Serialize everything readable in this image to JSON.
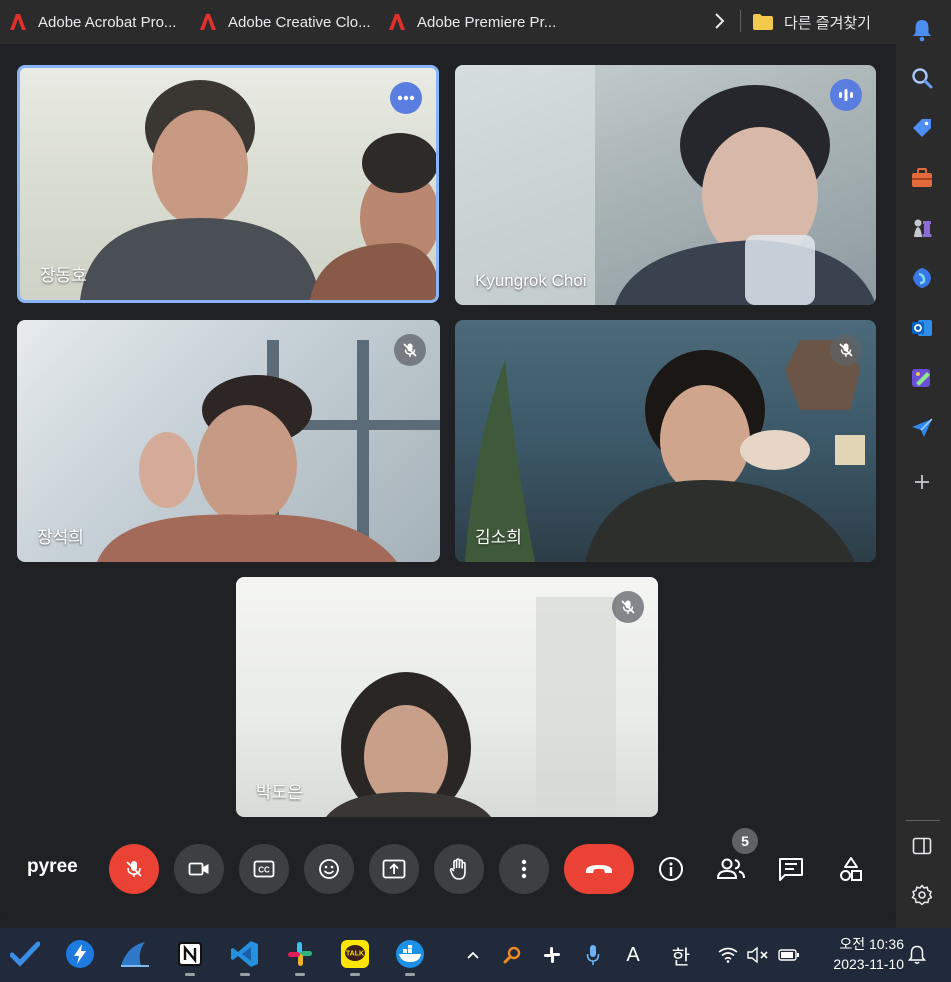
{
  "bookmarks": {
    "items": [
      {
        "label": "Adobe Acrobat Pro..."
      },
      {
        "label": "Adobe Creative Clo..."
      },
      {
        "label": "Adobe Premiere Pr..."
      }
    ],
    "other_label": "다른 즐겨찾기"
  },
  "tiles": [
    {
      "name": "장동호",
      "badge": "more-options-icon"
    },
    {
      "name": "Kyungrok Choi",
      "badge": "speaking-icon"
    },
    {
      "name": "장석희",
      "badge": "mic-off-icon"
    },
    {
      "name": "김소희",
      "badge": "mic-off-icon"
    },
    {
      "name": "박도은",
      "badge": "mic-off-icon"
    }
  ],
  "controls": {
    "meeting_name": "pyree",
    "participant_count": "5"
  },
  "clock": {
    "time": "오전 10:36",
    "date": "2023-11-10"
  },
  "tray": {
    "ime_mode": "A",
    "ime_lang": "한"
  },
  "colors": {
    "accent": "#8ab4f8",
    "danger": "#ea4335",
    "control_bg": "#3c4043",
    "speaking": "#5a7de0"
  }
}
